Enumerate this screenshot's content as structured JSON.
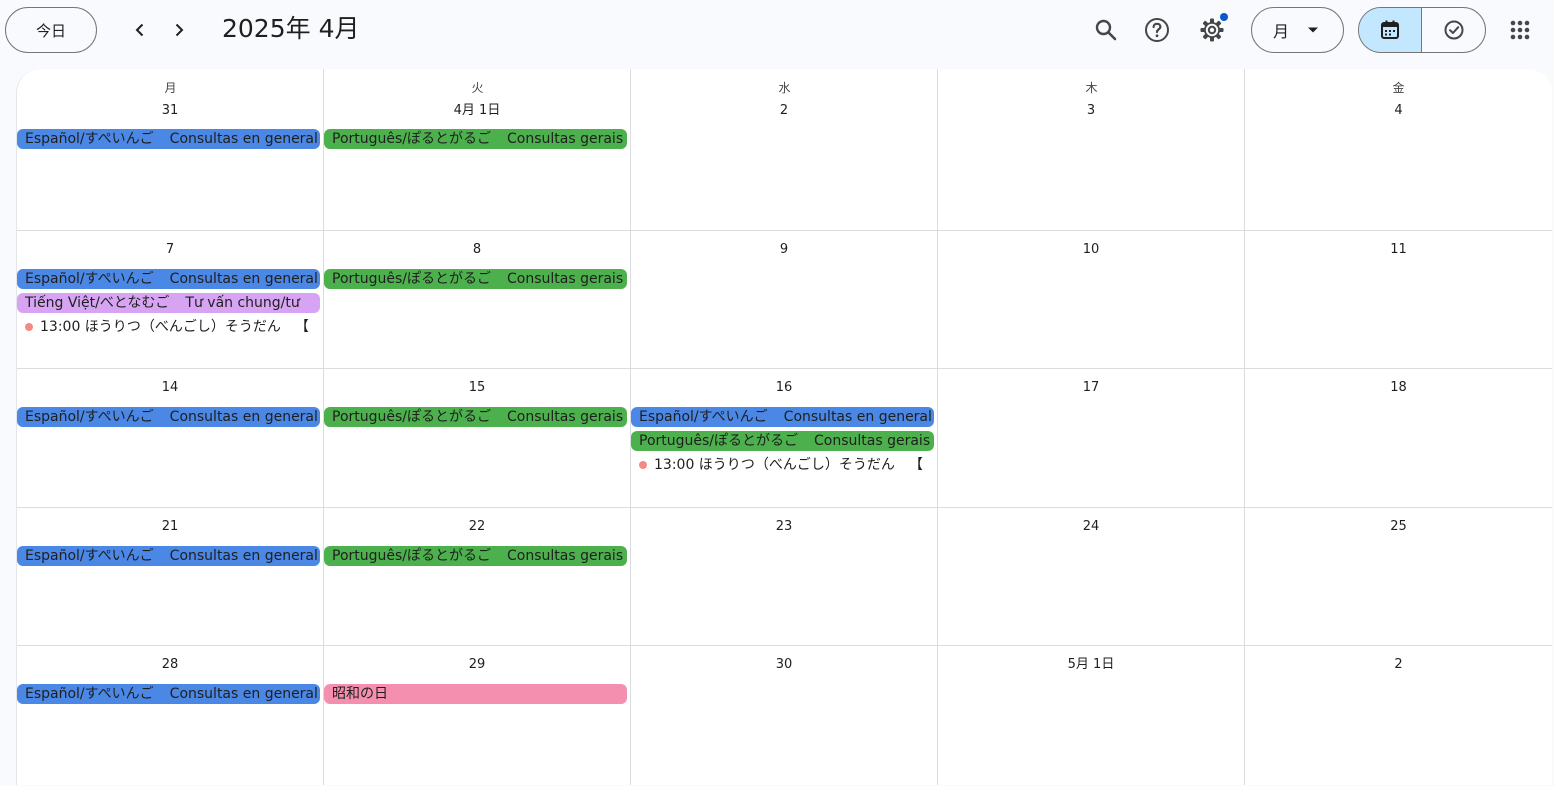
{
  "header": {
    "today_label": "今日",
    "month_title": "2025年 4月",
    "view_label": "月",
    "colors": {
      "settings_dot": "#0b57d0",
      "seg_active": "#c2e7ff"
    },
    "icons": [
      "chevron-left-icon",
      "chevron-right-icon",
      "search-icon",
      "help-icon",
      "gear-icon",
      "caret-down-icon",
      "calendar-icon",
      "task-check-icon",
      "apps-grid-icon"
    ]
  },
  "weekdays": [
    "月",
    "火",
    "水",
    "木",
    "金"
  ],
  "event_colors": {
    "blue": "#4b87e5",
    "green": "#4cb04d",
    "purple": "#d6a4f3",
    "pink": "#f58fb0",
    "dot": "#f28b82"
  },
  "weeks": [
    {
      "days": [
        {
          "num": "31",
          "events": [
            {
              "color": "blue",
              "title": "Español/すぺいんご",
              "detail": "Consultas en general"
            }
          ]
        },
        {
          "num": "4月 1日",
          "events": [
            {
              "color": "green",
              "title": "Português/ぽるとがるご",
              "detail": "Consultas gerais"
            }
          ]
        },
        {
          "num": "2",
          "events": []
        },
        {
          "num": "3",
          "events": []
        },
        {
          "num": "4",
          "events": []
        }
      ]
    },
    {
      "days": [
        {
          "num": "7",
          "events": [
            {
              "color": "blue",
              "title": "Español/すぺいんご",
              "detail": "Consultas en general"
            },
            {
              "color": "purple",
              "title": "Tiếng Việt/べとなむご",
              "detail": "Tư vấn chung/tư"
            },
            {
              "color": "dot",
              "title": "13:00 ほうりつ（べんごし）そうだん",
              "detail": "【"
            }
          ]
        },
        {
          "num": "8",
          "events": [
            {
              "color": "green",
              "title": "Português/ぽるとがるご",
              "detail": "Consultas gerais"
            }
          ]
        },
        {
          "num": "9",
          "events": []
        },
        {
          "num": "10",
          "events": []
        },
        {
          "num": "11",
          "events": []
        }
      ]
    },
    {
      "days": [
        {
          "num": "14",
          "events": [
            {
              "color": "blue",
              "title": "Español/すぺいんご",
              "detail": "Consultas en general"
            }
          ]
        },
        {
          "num": "15",
          "events": [
            {
              "color": "green",
              "title": "Português/ぽるとがるご",
              "detail": "Consultas gerais"
            }
          ]
        },
        {
          "num": "16",
          "events": [
            {
              "color": "blue",
              "title": "Español/すぺいんご",
              "detail": "Consultas en general"
            },
            {
              "color": "green",
              "title": "Português/ぽるとがるご",
              "detail": "Consultas gerais"
            },
            {
              "color": "dot",
              "title": "13:00 ほうりつ（べんごし）そうだん",
              "detail": "【"
            }
          ]
        },
        {
          "num": "17",
          "events": []
        },
        {
          "num": "18",
          "events": []
        }
      ]
    },
    {
      "days": [
        {
          "num": "21",
          "events": [
            {
              "color": "blue",
              "title": "Español/すぺいんご",
              "detail": "Consultas en general"
            }
          ]
        },
        {
          "num": "22",
          "events": [
            {
              "color": "green",
              "title": "Português/ぽるとがるご",
              "detail": "Consultas gerais"
            }
          ]
        },
        {
          "num": "23",
          "events": []
        },
        {
          "num": "24",
          "events": []
        },
        {
          "num": "25",
          "events": []
        }
      ]
    },
    {
      "days": [
        {
          "num": "28",
          "events": [
            {
              "color": "blue",
              "title": "Español/すぺいんご",
              "detail": "Consultas en general"
            }
          ]
        },
        {
          "num": "29",
          "events": [
            {
              "color": "pink",
              "title": "昭和の日",
              "detail": ""
            }
          ]
        },
        {
          "num": "30",
          "events": []
        },
        {
          "num": "5月 1日",
          "events": []
        },
        {
          "num": "2",
          "events": []
        }
      ]
    }
  ]
}
